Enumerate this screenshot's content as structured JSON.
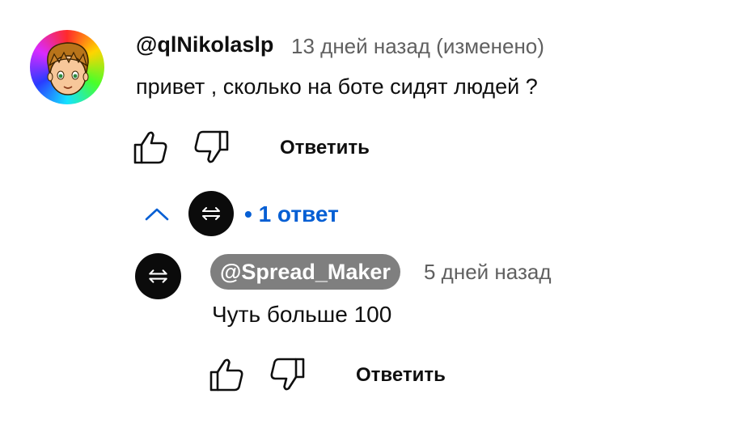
{
  "comment": {
    "author": "@qlNikolaslp",
    "meta": "13 дней назад (изменено)",
    "text": "привет , сколько на боте сидят людей ?",
    "reply_label": "Ответить",
    "avatar_icon": "cartoon-boy-avatar"
  },
  "replies": {
    "count_label": "• 1 ответ",
    "toggle_icon": "chevron-up-icon",
    "accent_color": "#065fd4"
  },
  "reply": {
    "author": "@Spread_Maker",
    "meta": "5 дней назад",
    "text": "Чуть больше 100",
    "reply_label": "Ответить",
    "avatar_icon": "swap-arrows-avatar"
  }
}
